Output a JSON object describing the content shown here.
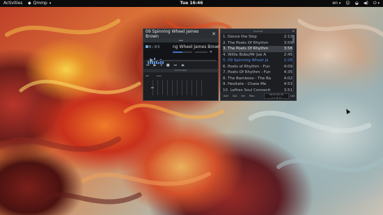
{
  "topbar": {
    "activities": "Activities",
    "app_menu": "Qmmp",
    "clock": "Tue 16:46",
    "keyboard_layout": "en"
  },
  "player": {
    "window_title": "09 Spinning Wheel James Brown",
    "display_title": "ng Wheel James Brown",
    "time": "0:03",
    "eq_header": "EQUALIZER",
    "eq_on_label": "ON",
    "eq_auto_label": "Auto",
    "volume_level": 0.5,
    "seek_position": 0.05
  },
  "playlist": {
    "header": "PLAYLIST",
    "items": [
      {
        "title": "1. Dance the Slop",
        "duration": "2:13",
        "state": "normal"
      },
      {
        "title": "2. The Poets Of Rhythm",
        "duration": "3:59",
        "state": "normal"
      },
      {
        "title": "3. The Poets Of Rhythm",
        "duration": "3:58",
        "state": "selected"
      },
      {
        "title": "4. Willie Bobo/Mr Joe A",
        "duration": "2:45",
        "state": "normal"
      },
      {
        "title": "5. 09 Spinning Wheel Ja",
        "duration": "2:26",
        "state": "current"
      },
      {
        "title": "6. Poets of Rhythm - Fun",
        "duration": "4:09",
        "state": "normal"
      },
      {
        "title": "7. Poets Of Rhythm - Fun",
        "duration": "4:35",
        "state": "normal"
      },
      {
        "title": "8. The Bamboos - The Ba",
        "duration": "4:02",
        "state": "normal"
      },
      {
        "title": "9. Hesitate - Chase Me",
        "duration": "4:53",
        "state": "normal"
      },
      {
        "title": "10. Lefties Soul Connecti",
        "duration": "3:51",
        "state": "normal"
      }
    ],
    "footer_buttons": [
      "Add",
      "Sub",
      "Sel",
      "Misc"
    ],
    "footer_list_button": "List",
    "footer_time": "00:03/02:26"
  }
}
